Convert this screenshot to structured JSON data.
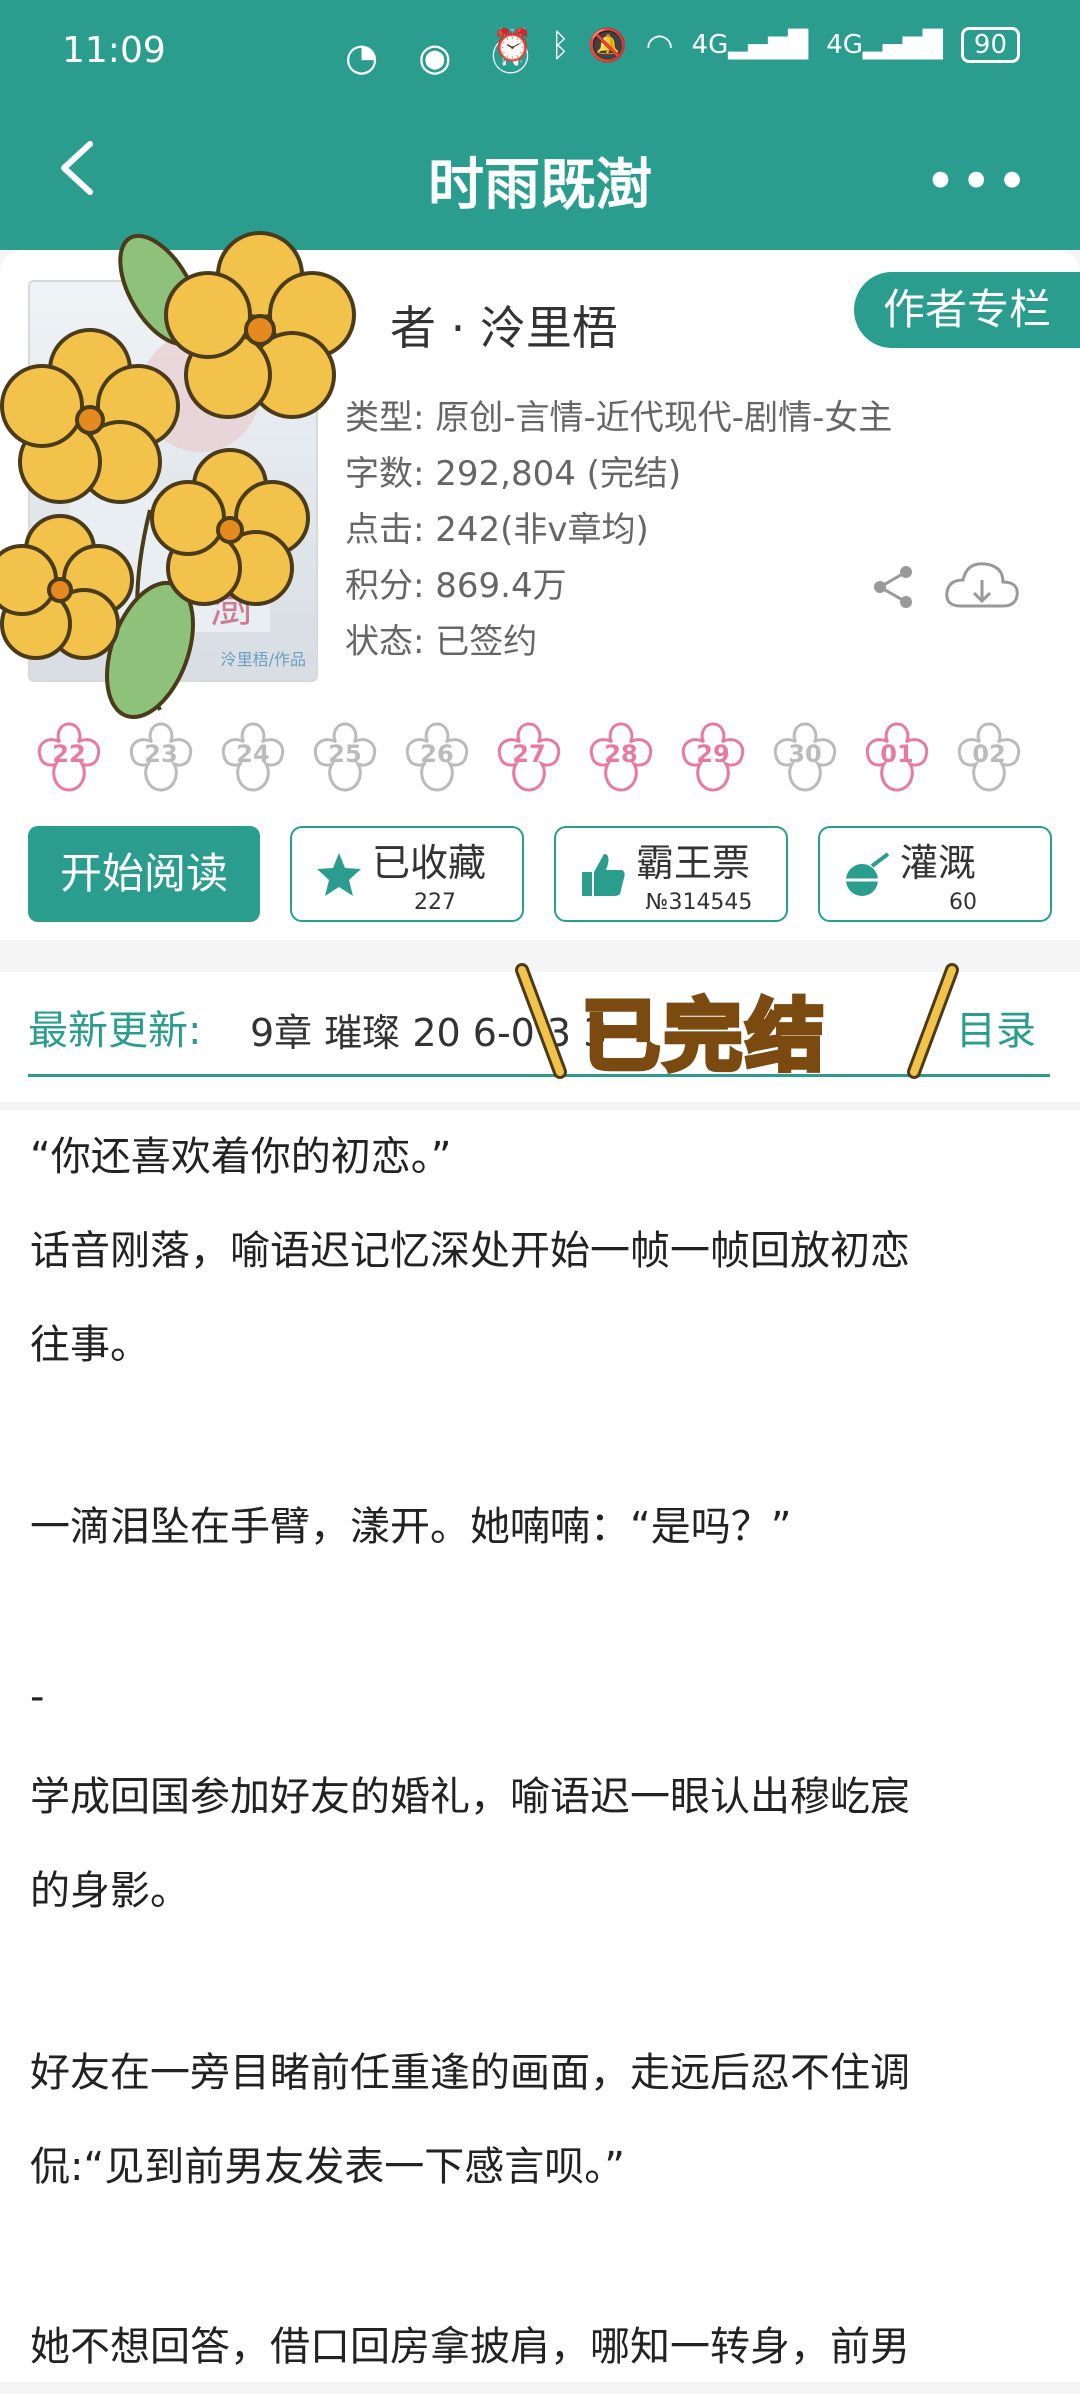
{
  "status_bar": {
    "time": "11:09",
    "battery": "90",
    "network": "4G"
  },
  "nav": {
    "title": "时雨既澍",
    "back_icon": "back-chevron-icon",
    "more_icon": "more-dots-icon"
  },
  "book": {
    "author": "者 · 泠里梧",
    "author_column": "作者专栏",
    "meta": [
      "类型: 原创-言情-近代现代-剧情-女主",
      "字数: 292,804 (完结)",
      "点击: 242(非v章均)",
      "积分: 869.4万",
      "状态: 已签约"
    ],
    "cover_caption": "泠里梧/作品"
  },
  "badges": [
    {
      "num": "22",
      "active": true
    },
    {
      "num": "23",
      "active": false
    },
    {
      "num": "24",
      "active": false
    },
    {
      "num": "25",
      "active": false
    },
    {
      "num": "26",
      "active": false
    },
    {
      "num": "27",
      "active": true
    },
    {
      "num": "28",
      "active": true
    },
    {
      "num": "29",
      "active": true
    },
    {
      "num": "30",
      "active": false
    },
    {
      "num": "01",
      "active": true
    },
    {
      "num": "02",
      "active": false
    }
  ],
  "actions": {
    "read": "开始阅读",
    "favorite": {
      "label": "已收藏",
      "count": "227"
    },
    "vote": {
      "label": "霸王票",
      "count": "№314545"
    },
    "water": {
      "label": "灌溉",
      "count": "60"
    }
  },
  "latest": {
    "label": "最新更新:",
    "chapter": "9章  璀璨  20 6-0  3   3",
    "toc": "目录"
  },
  "stamp": {
    "text": "已完结"
  },
  "description": [
    "“你还喜欢着你的初恋。”",
    "话音刚落，喻语迟记忆深处开始一帧一帧回放初恋",
    "往事。",
    "一滴泪坠在手臂，漾开。她喃喃：“是吗？”",
    "-",
    "学成回国参加好友的婚礼，喻语迟一眼认出穆屹宸",
    "的身影。",
    "好友在一旁目睹前任重逢的画面，走远后忍不住调",
    "侃:“见到前男友发表一下感言呗。”",
    "她不想回答，借口回房拿披肩，哪知一转身，前男"
  ],
  "colors": {
    "brand": "#2a9d8f",
    "badge_active": "#e87aa0",
    "badge_inactive": "#bbbbbb"
  }
}
